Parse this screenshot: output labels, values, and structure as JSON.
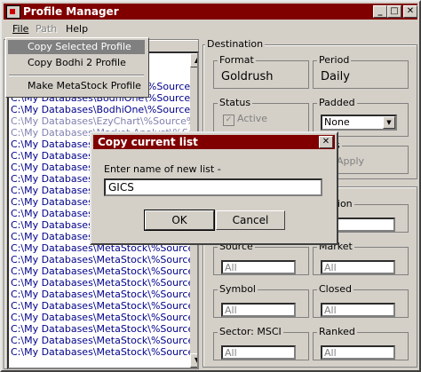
{
  "window": {
    "title": "Profile Manager",
    "controls": {
      "minimize": "_",
      "maximize": "□",
      "close": "✕"
    }
  },
  "menu": {
    "file": "File",
    "path": "Path",
    "help": "Help"
  },
  "file_menu": {
    "items": [
      {
        "label": "Copy Selected Profile"
      },
      {
        "label": "Copy Bodhi 2 Profile"
      },
      {
        "label": "Make MetaStock Profile"
      }
    ]
  },
  "profile_list": {
    "rows": [
      "C:\\My Databases\\BodhiOne\\%Source%",
      "C:\\My Databases\\BodhiOne\\%Source%\\",
      "C:\\My Databases\\BodhiOne\\%Source%\\S",
      "C:\\My Databases\\EzyChart\\%Source%",
      "C:\\My Databases\\Market Analyst\\%Source%",
      "C:\\My Databases\\MetaStock\\%Source%\\",
      "C:\\My Databases\\MetaStock\\%Source%\\",
      "C:\\My Databases\\MetaStock\\%Source%\\",
      "C:\\My Databases\\MetaStock\\%Source%\\",
      "C:\\My Databases\\MetaStock\\%Source%\\",
      "C:\\My Databases\\MetaStock\\%Source%\\",
      "C:\\My Databases\\MetaStock\\%Source%\\",
      "C:\\My Databases\\MetaStock\\%Source%\\",
      "C:\\My Databases\\MetaStock\\%Source%\\",
      "C:\\My Databases\\MetaStock\\%Source%\\",
      "C:\\My Databases\\MetaStock\\%Source%\\",
      "C:\\My Databases\\MetaStock\\%Source%\\",
      "C:\\My Databases\\MetaStock\\%Source%\\",
      "C:\\My Databases\\MetaStock\\%Source%\\",
      "C:\\My Databases\\MetaStock\\%Source%\\",
      "C:\\My Databases\\MetaStock\\%Source%\\",
      "C:\\My Databases\\MetaStock\\%Source%\\",
      "C:\\My Databases\\MetaStock\\%Source%\\",
      "C:\\My Databases\\MetaStock\\%Source%\\"
    ]
  },
  "destination": {
    "label": "Destination",
    "format_label": "Format",
    "format_value": "Goldrush",
    "period_label": "Period",
    "period_value": "Daily",
    "status_label": "Status",
    "status_checkbox": "Active",
    "padded_label": "Padded",
    "padded_value": "None",
    "adjustments_label": "ents",
    "adjustments_checkbox": "Apply"
  },
  "filters": {
    "region_label": "Region",
    "region_value": "",
    "source_label": "Source",
    "source_value": "All",
    "market_label": "Market",
    "market_value": "All",
    "symbol_label": "Symbol",
    "symbol_value": "All",
    "closed_label": "Closed",
    "closed_value": "All",
    "sector_label": "Sector: MSCI",
    "sector_value": "All",
    "ranked_label": "Ranked",
    "ranked_value": "All"
  },
  "dialog": {
    "title": "Copy current list",
    "close": "✕",
    "prompt": "Enter name of new list -",
    "input_value": "GICS",
    "ok_label": "OK",
    "cancel_label": "Cancel"
  },
  "colors": {
    "titlebar": "#800000",
    "face": "#d4d0c8",
    "list_text": "#00008b"
  }
}
